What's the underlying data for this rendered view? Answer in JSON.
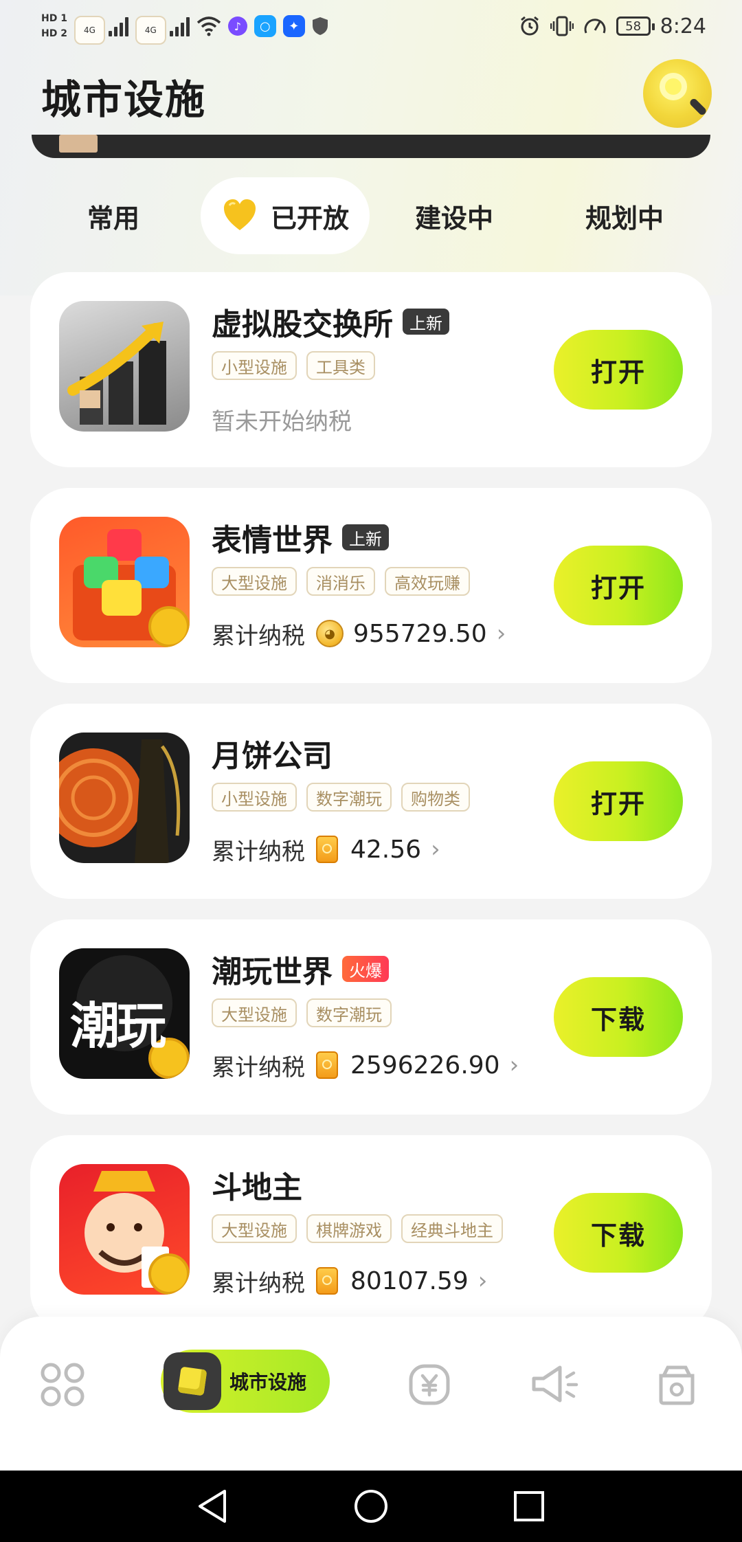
{
  "status_bar": {
    "sim1": "HD 1",
    "sim2": "HD 2",
    "net1": "4G",
    "net2": "4G",
    "battery": "58",
    "time": "8:24"
  },
  "header": {
    "title": "城市设施",
    "search_icon": "magnifier-icon"
  },
  "tabs": [
    {
      "label": "常用"
    },
    {
      "label": "已开放",
      "active": true,
      "icon": "heart-icon"
    },
    {
      "label": "建设中"
    },
    {
      "label": "规划中"
    }
  ],
  "apps": [
    {
      "name": "虚拟股交换所",
      "badge": "上新",
      "badge_style": "dark",
      "tags": [
        "小型设施",
        "工具类"
      ],
      "tax_status": "暂未开始纳税",
      "button": "打开",
      "icon": "stock-exchange-icon"
    },
    {
      "name": "表情世界",
      "badge": "上新",
      "badge_style": "dark",
      "tags": [
        "大型设施",
        "消消乐",
        "高效玩赚"
      ],
      "tax_label": "累计纳税",
      "tax_icon": "coin-icon",
      "tax_value": "955729.50",
      "button": "打开",
      "icon": "emoji-world-icon"
    },
    {
      "name": "月饼公司",
      "tags": [
        "小型设施",
        "数字潮玩",
        "购物类"
      ],
      "tax_label": "累计纳税",
      "tax_icon": "jar-icon",
      "tax_value": "42.56",
      "button": "打开",
      "icon": "mooncake-icon"
    },
    {
      "name": "潮玩世界",
      "badge": "火爆",
      "badge_style": "hot",
      "tags": [
        "大型设施",
        "数字潮玩"
      ],
      "tax_label": "累计纳税",
      "tax_icon": "jar-icon",
      "tax_value": "2596226.90",
      "button": "下载",
      "icon": "chaowan-icon",
      "icon_text": "潮玩"
    },
    {
      "name": "斗地主",
      "tags": [
        "大型设施",
        "棋牌游戏",
        "经典斗地主"
      ],
      "tax_label": "累计纳税",
      "tax_icon": "jar-icon",
      "tax_value": "80107.59",
      "button": "下载",
      "icon": "doudizhu-icon"
    }
  ],
  "bottom_nav": {
    "active_label": "城市设施",
    "items": [
      "grid-icon",
      "city-cube-icon",
      "yuan-icon",
      "megaphone-icon",
      "bag-icon"
    ]
  },
  "colors": {
    "accent": "#c8f020",
    "title": "#1a1a1a",
    "tag_text": "#a88f62"
  }
}
